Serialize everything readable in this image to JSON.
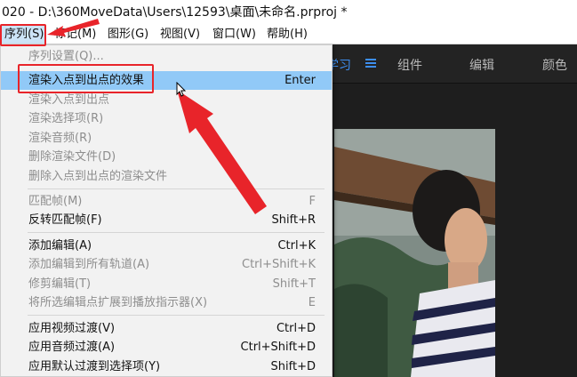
{
  "window": {
    "title": "020 - D:\\360MoveData\\Users\\12593\\桌面\\未命名.prproj *"
  },
  "menubar": {
    "items": [
      {
        "label": "序列(S)",
        "active": true
      },
      {
        "label": "标记(M)"
      },
      {
        "label": "图形(G)"
      },
      {
        "label": "视图(V)"
      },
      {
        "label": "窗口(W)"
      },
      {
        "label": "帮助(H)"
      }
    ]
  },
  "workspaces": {
    "active_partial": "学习",
    "items": [
      "组件",
      "编辑",
      "颜色"
    ]
  },
  "dropdown": {
    "items": [
      {
        "label": "序列设置(Q)...",
        "shortcut": "",
        "enabled": false
      },
      {
        "label": "渲染入点到出点的效果",
        "shortcut": "Enter",
        "enabled": true,
        "highlighted": true
      },
      {
        "label": "渲染入点到出点",
        "shortcut": "",
        "enabled": false
      },
      {
        "label": "渲染选择项(R)",
        "shortcut": "",
        "enabled": false
      },
      {
        "label": "渲染音频(R)",
        "shortcut": "",
        "enabled": false
      },
      {
        "label": "删除渲染文件(D)",
        "shortcut": "",
        "enabled": false
      },
      {
        "label": "删除入点到出点的渲染文件",
        "shortcut": "",
        "enabled": false
      },
      {
        "label": "匹配帧(M)",
        "shortcut": "F",
        "enabled": false
      },
      {
        "label": "反转匹配帧(F)",
        "shortcut": "Shift+R",
        "enabled": true
      },
      {
        "label": "添加编辑(A)",
        "shortcut": "Ctrl+K",
        "enabled": true
      },
      {
        "label": "添加编辑到所有轨道(A)",
        "shortcut": "Ctrl+Shift+K",
        "enabled": false
      },
      {
        "label": "修剪编辑(T)",
        "shortcut": "Shift+T",
        "enabled": false
      },
      {
        "label": "将所选编辑点扩展到播放指示器(X)",
        "shortcut": "E",
        "enabled": false
      },
      {
        "label": "应用视频过渡(V)",
        "shortcut": "Ctrl+D",
        "enabled": true
      },
      {
        "label": "应用音频过渡(A)",
        "shortcut": "Ctrl+Shift+D",
        "enabled": true
      },
      {
        "label": "应用默认过渡到选择项(Y)",
        "shortcut": "Shift+D",
        "enabled": true
      }
    ]
  },
  "colors": {
    "accent": "#3d8ef0",
    "annotation_red": "#e8242a",
    "menu_highlight": "#91c9f7"
  }
}
